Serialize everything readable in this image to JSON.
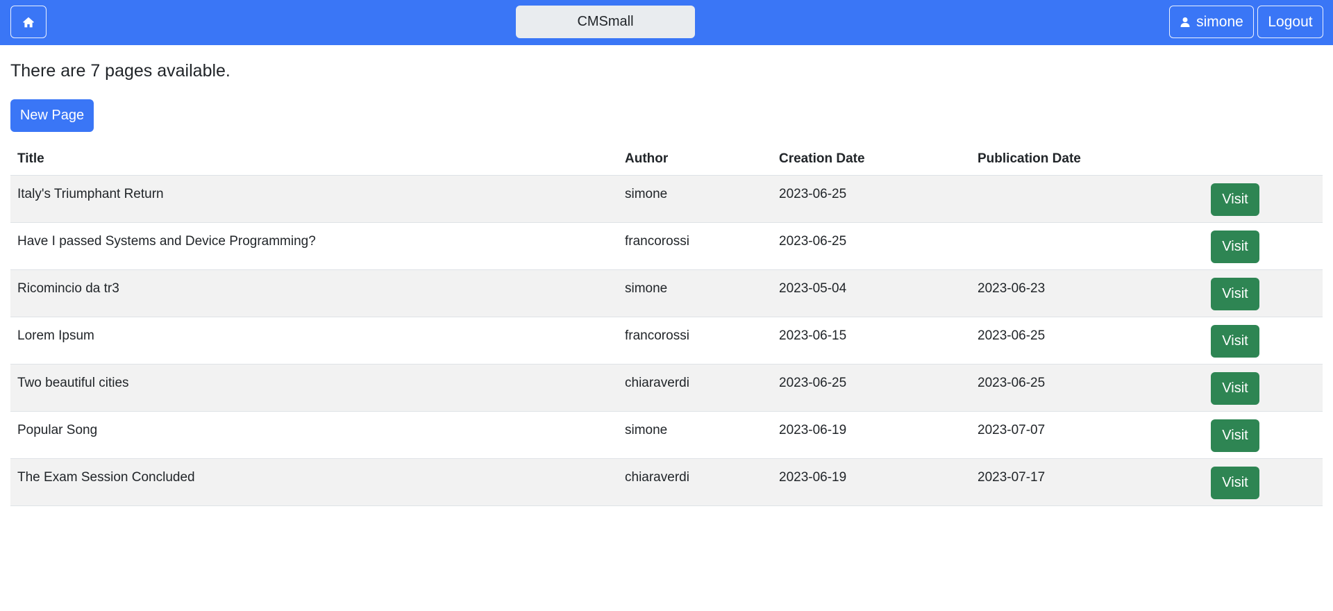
{
  "navbar": {
    "home_icon": "house-icon",
    "brand": "CMSmall",
    "user_icon": "person-icon",
    "username": "simone",
    "logout_label": "Logout",
    "color": "#3a76f6"
  },
  "main": {
    "summary": "There are 7 pages available.",
    "new_page_label": "New Page"
  },
  "table": {
    "headers": [
      "Title",
      "Author",
      "Creation Date",
      "Publication Date"
    ],
    "visit_label": "Visit",
    "rows": [
      {
        "title": "Italy's Triumphant Return",
        "author": "simone",
        "created": "2023-06-25",
        "published": ""
      },
      {
        "title": "Have I passed Systems and Device Programming?",
        "author": "francorossi",
        "created": "2023-06-25",
        "published": ""
      },
      {
        "title": "Ricomincio da tr3",
        "author": "simone",
        "created": "2023-05-04",
        "published": "2023-06-23"
      },
      {
        "title": "Lorem Ipsum",
        "author": "francorossi",
        "created": "2023-06-15",
        "published": "2023-06-25"
      },
      {
        "title": "Two beautiful cities",
        "author": "chiaraverdi",
        "created": "2023-06-25",
        "published": "2023-06-25"
      },
      {
        "title": "Popular Song",
        "author": "simone",
        "created": "2023-06-19",
        "published": "2023-07-07"
      },
      {
        "title": "The Exam Session Concluded",
        "author": "chiaraverdi",
        "created": "2023-06-19",
        "published": "2023-07-17"
      }
    ]
  }
}
